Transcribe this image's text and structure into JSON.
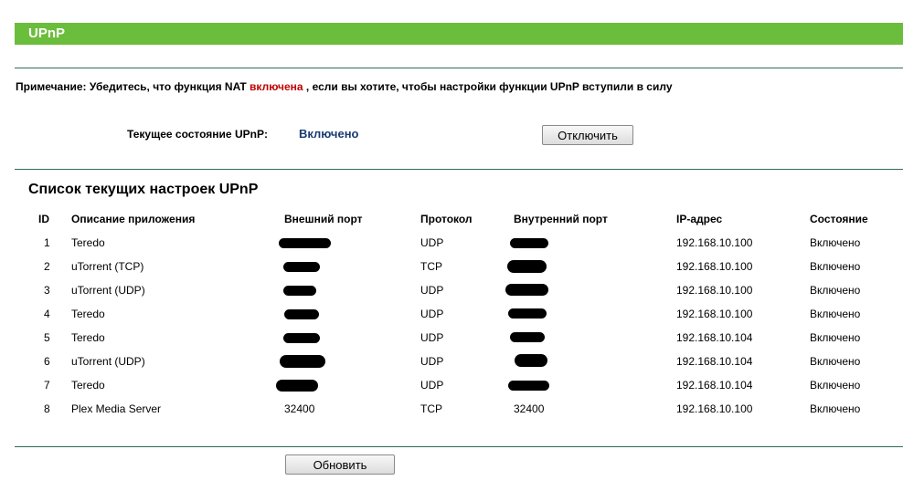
{
  "header": {
    "title": "UPnP"
  },
  "note": {
    "prefix": "Примечание: Убедитесь, что функция NAT",
    "highlight": "включена",
    "suffix": ", если вы хотите, чтобы настройки функции UPnP вступили в силу"
  },
  "status": {
    "label": "Текущее состояние UPnP:",
    "value": "Включено",
    "button_label": "Отключить"
  },
  "list": {
    "title": "Список текущих настроек UPnP",
    "columns": [
      "ID",
      "Описание приложения",
      "Внешний порт",
      "Протокол",
      "Внутренний порт",
      "IP-адрес",
      "Состояние"
    ],
    "rows": [
      {
        "id": "1",
        "app": "Teredo",
        "ext_port": "",
        "protocol": "UDP",
        "int_port": "",
        "ip": "192.168.10.100",
        "state": "Включено"
      },
      {
        "id": "2",
        "app": "uTorrent (TCP)",
        "ext_port": "",
        "protocol": "TCP",
        "int_port": "",
        "ip": "192.168.10.100",
        "state": "Включено"
      },
      {
        "id": "3",
        "app": "uTorrent (UDP)",
        "ext_port": "",
        "protocol": "UDP",
        "int_port": "",
        "ip": "192.168.10.100",
        "state": "Включено"
      },
      {
        "id": "4",
        "app": "Teredo",
        "ext_port": "",
        "protocol": "UDP",
        "int_port": "",
        "ip": "192.168.10.100",
        "state": "Включено"
      },
      {
        "id": "5",
        "app": "Teredo",
        "ext_port": "",
        "protocol": "UDP",
        "int_port": "",
        "ip": "192.168.10.104",
        "state": "Включено"
      },
      {
        "id": "6",
        "app": "uTorrent (UDP)",
        "ext_port": "",
        "protocol": "UDP",
        "int_port": "",
        "ip": "192.168.10.104",
        "state": "Включено"
      },
      {
        "id": "7",
        "app": "Teredo",
        "ext_port": "",
        "protocol": "UDP",
        "int_port": "",
        "ip": "192.168.10.104",
        "state": "Включено"
      },
      {
        "id": "8",
        "app": "Plex Media Server",
        "ext_port": "32400",
        "protocol": "TCP",
        "int_port": "32400",
        "ip": "192.168.10.100",
        "state": "Включено"
      }
    ]
  },
  "footer": {
    "refresh_label": "Обновить"
  },
  "colors": {
    "title_bar": "#6bbd3c",
    "highlight": "#c00000",
    "status_value": "#1a3a73",
    "divider": "#2f6f53"
  }
}
